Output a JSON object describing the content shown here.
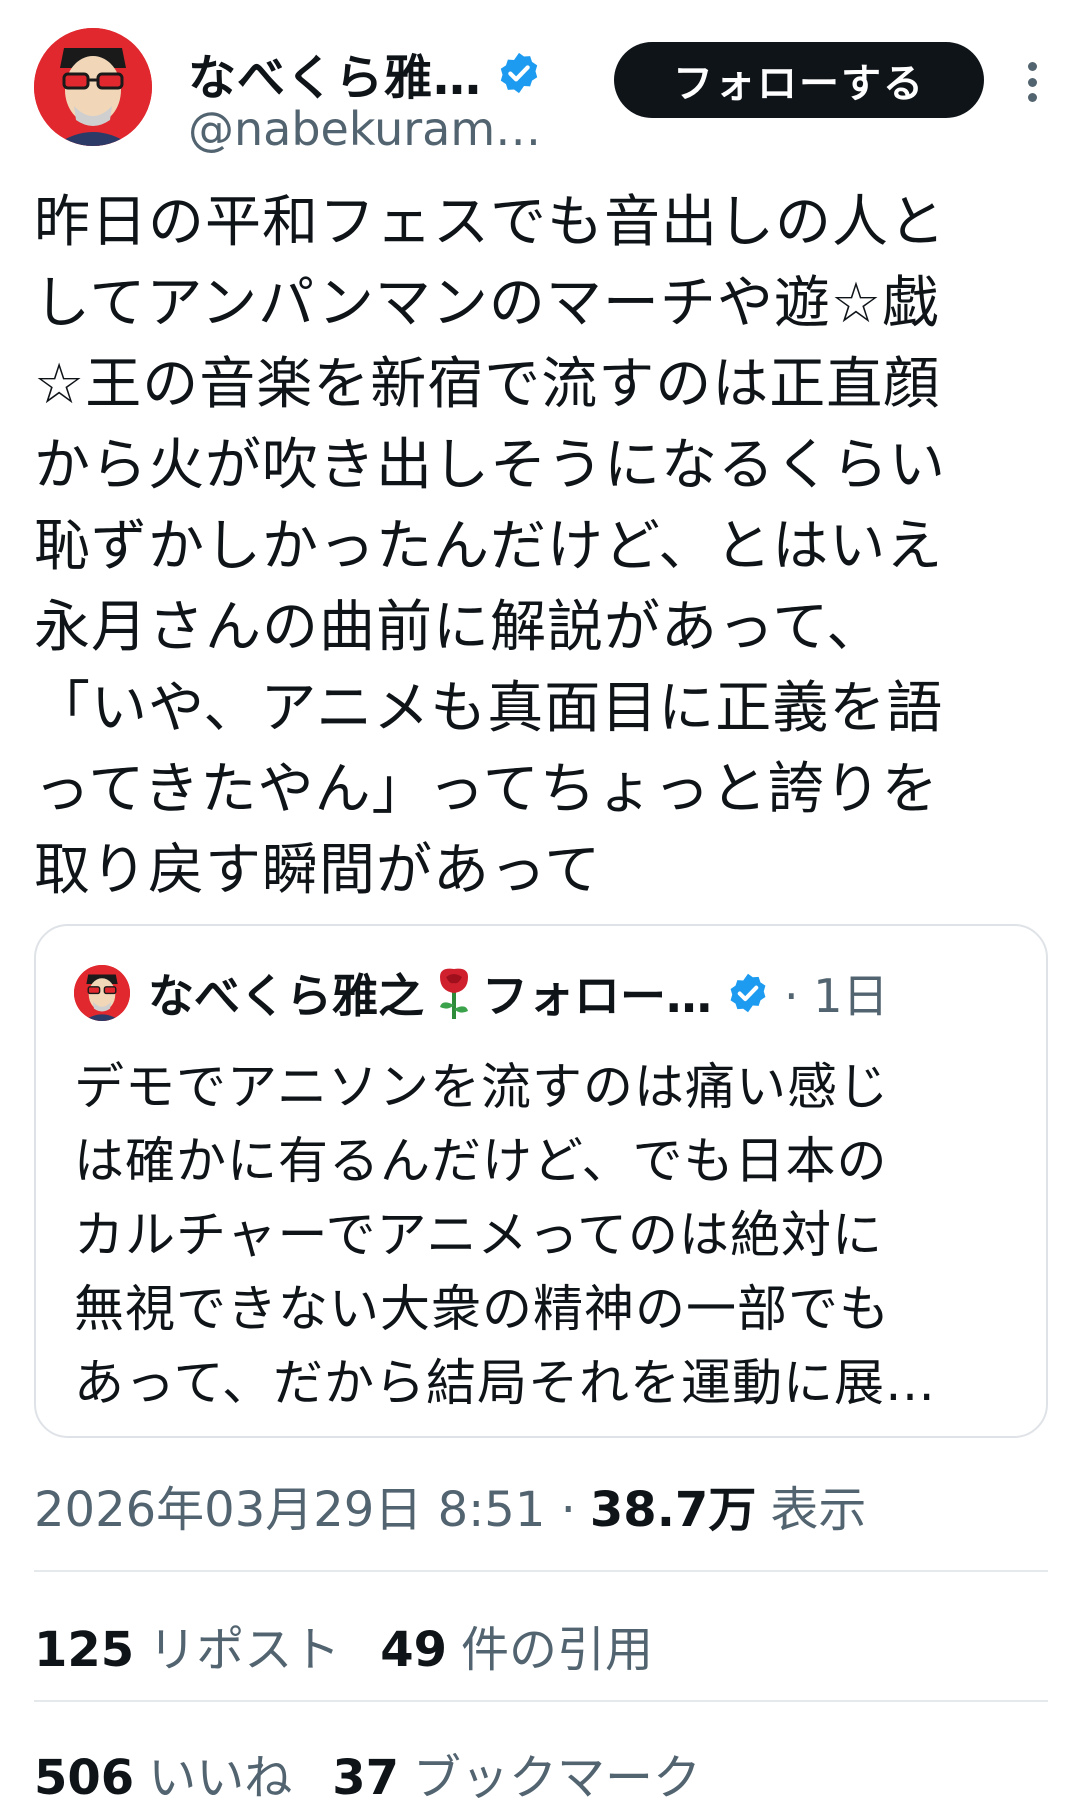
{
  "author": {
    "display_name": "なべくら雅…",
    "handle": "@nabekuram…",
    "avatar_icon": "avatar-sunglasses-portrait",
    "verified_icon": "verified-badge-icon"
  },
  "follow_button": {
    "label": "フォローする"
  },
  "tweet": {
    "lines": [
      "昨日の平和フェスでも音出しの人と",
      "してアンパンマンのマーチや遊☆戯",
      "☆王の音楽を新宿で流すのは正直顔",
      "から火が吹き出しそうになるくらい",
      "恥ずかしかったんだけど、とはいえ",
      "永月さんの曲前に解説があって、",
      "「いや、アニメも真面目に正義を語",
      "ってきたやん」ってちょっと誇りを",
      "取り戻す瞬間があって"
    ]
  },
  "quote": {
    "name": "なべくら雅之",
    "rose_icon": "rose-emoji",
    "tag": "フォロー…",
    "time": "· 1日",
    "lines": [
      "デモでアニソンを流すのは痛い感じ",
      "は確かに有るんだけど、でも日本の",
      "カルチャーでアニメってのは絶対に",
      "無視できない大衆の精神の一部でも",
      "あって、だから結局それを運動に展…"
    ]
  },
  "meta": {
    "timestamp": "2026年03月29日 8:51 ·",
    "views_count": "38.7万",
    "views_label": "表示"
  },
  "stats": {
    "reposts_count": "125",
    "reposts_label": "リポスト",
    "quotes_count": "49",
    "quotes_label": "件の引用",
    "likes_count": "506",
    "likes_label": "いいね",
    "bookmarks_count": "37",
    "bookmarks_label": "ブックマーク"
  },
  "colors": {
    "text": "#0f1419",
    "secondary": "#536471",
    "verified": "#1d9bf0",
    "avatar_bg": "#e0282e"
  }
}
